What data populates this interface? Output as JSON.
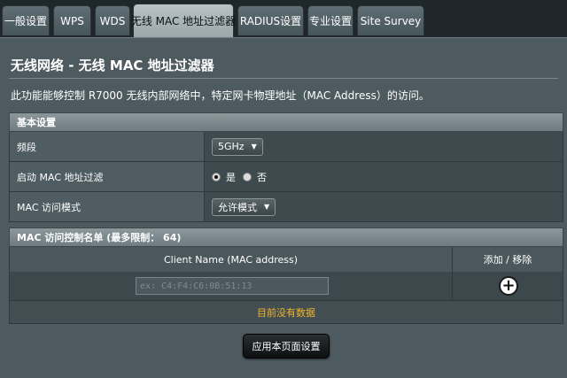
{
  "tabs": [
    {
      "label": "一般设置",
      "active": false
    },
    {
      "label": "WPS",
      "active": false
    },
    {
      "label": "WDS",
      "active": false
    },
    {
      "label": "无线 MAC 地址过滤器",
      "active": true
    },
    {
      "label": "RADIUS设置",
      "active": false
    },
    {
      "label": "专业设置",
      "active": false
    },
    {
      "label": "Site Survey",
      "active": false
    }
  ],
  "page": {
    "title": "无线网络 - 无线 MAC 地址过滤器",
    "description": "此功能能够控制 R7000 无线内部网络中，特定网卡物理地址（MAC Address）的访问。"
  },
  "basic": {
    "header": "基本设置",
    "band_label": "频段",
    "band_value": "5GHz",
    "enable_label": "启动 MAC 地址过滤",
    "yes_label": "是",
    "no_label": "否",
    "enable_selected": "yes",
    "mode_label": "MAC 访问模式",
    "mode_value": "允许模式"
  },
  "mac_list": {
    "header": "MAC 访问控制名单 (最多限制： 64)",
    "col_client": "Client Name (MAC address)",
    "col_action": "添加 / 移除",
    "input_placeholder": "ex: C4:F4:C6:0B:51:13",
    "empty_text": "目前没有数据"
  },
  "apply_label": "应用本页面设置",
  "colors": {
    "background": "#1f272a",
    "panel": "#4d5a5f",
    "accent_warning": "#f0b429"
  },
  "icons": {
    "add": "plus-circle-icon",
    "dropdown": "caret-down-icon"
  }
}
